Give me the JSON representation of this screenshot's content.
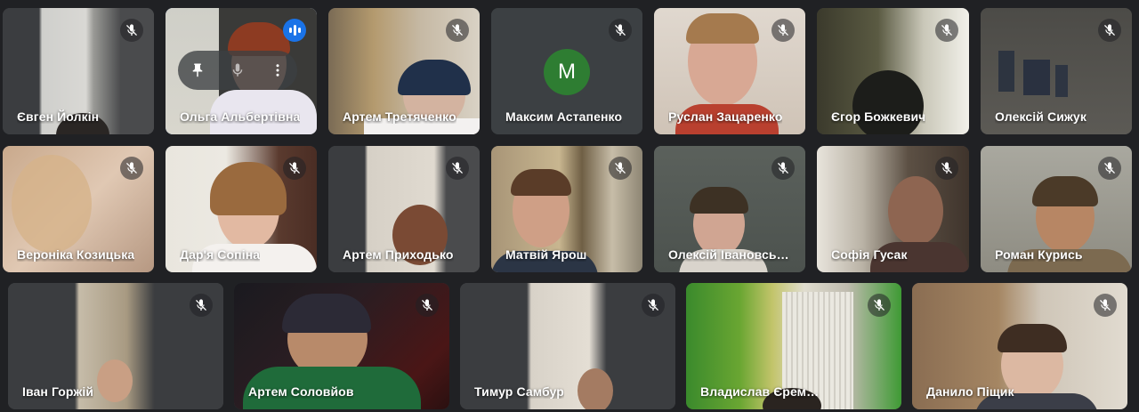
{
  "participants": [
    {
      "name": "Євген Йолкін",
      "muted": true
    },
    {
      "name": "Ольга Альбертівна",
      "speaking": true,
      "active": true
    },
    {
      "name": "Артем Третяченко",
      "muted": true
    },
    {
      "name": "Максим Астапенко",
      "muted": true,
      "avatar_letter": "M"
    },
    {
      "name": "Руслан Зацаренко",
      "muted": true
    },
    {
      "name": "Єгор Божкевич",
      "muted": true
    },
    {
      "name": "Олексій Сижук",
      "muted": true
    },
    {
      "name": "Вероніка Козицька",
      "muted": true
    },
    {
      "name": "Дар'я Сопіна",
      "muted": true
    },
    {
      "name": "Артем Приходько",
      "muted": true
    },
    {
      "name": "Матвій Ярош",
      "muted": true
    },
    {
      "name": "Олексій Івановський",
      "muted": true
    },
    {
      "name": "Софія Гусак",
      "muted": true
    },
    {
      "name": "Роман Курись",
      "muted": true
    },
    {
      "name": "Іван Горжій",
      "muted": true
    },
    {
      "name": "Артем Соловйов",
      "muted": true
    },
    {
      "name": "Тимур Самбур",
      "muted": true
    },
    {
      "name": "Владислав Єремєєв",
      "muted": true
    },
    {
      "name": "Данило Піщик",
      "muted": true
    }
  ],
  "hover_controls": {
    "icons": [
      "pin-icon",
      "mic-icon",
      "more-options-icon"
    ]
  },
  "colors": {
    "background": "#202124",
    "tile": "#3c4043",
    "active_border": "#8ab4f8",
    "speaking_badge": "#1a73e8",
    "avatar": "#2e7d32"
  }
}
